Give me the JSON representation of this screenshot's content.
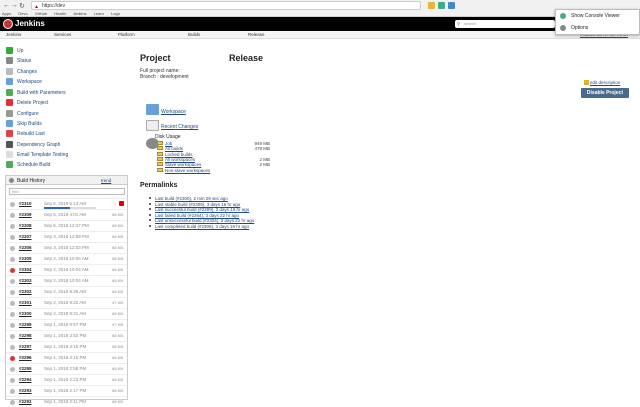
{
  "browser": {
    "url": "https://dev",
    "bookmarks": [
      "Apps",
      "Devo",
      "GitHub",
      "Health",
      "Jenkins",
      "Learn",
      "Logo"
    ]
  },
  "header": {
    "brand": "Jenkins",
    "search_placeholder": "search"
  },
  "breadcrumbs": [
    "Jenkins",
    "Services",
    "Platform",
    "Builds",
    "Release"
  ],
  "auto_refresh": "ENABLE AUTO REFRESH",
  "context_menu": {
    "items": [
      "Show Console Viewer",
      "Options"
    ]
  },
  "sidebar": {
    "tasks": [
      {
        "label": "Up",
        "icon": "up-arrow-icon",
        "color": "#3a3"
      },
      {
        "label": "Status",
        "icon": "search-icon",
        "color": "#888"
      },
      {
        "label": "Changes",
        "icon": "notepad-icon",
        "color": "#bbb"
      },
      {
        "label": "Workspace",
        "icon": "folder-icon",
        "color": "#6a9fd8"
      },
      {
        "label": "Build with Parameters",
        "icon": "build-icon",
        "color": "#5a5"
      },
      {
        "label": "Delete Project",
        "icon": "delete-icon",
        "color": "#d33"
      },
      {
        "label": "Configure",
        "icon": "gear-icon",
        "color": "#999"
      },
      {
        "label": "Skip Builds",
        "icon": "skip-icon",
        "color": "#6a9fd8"
      },
      {
        "label": "Rebuild Last",
        "icon": "rebuild-icon",
        "color": "#d44"
      },
      {
        "label": "Dependency Graph",
        "icon": "graph-icon",
        "color": "#555"
      },
      {
        "label": "Email Template Testing",
        "icon": "email-icon",
        "color": "#ddd"
      },
      {
        "label": "Schedule Build",
        "icon": "clock-icon",
        "color": "#5a5"
      }
    ]
  },
  "build_history": {
    "title": "Build History",
    "trend": "trend",
    "filter_placeholder": "find",
    "builds": [
      {
        "num": "#2310",
        "date": "Sep 6, 2018 6:13 AM",
        "size": "",
        "status": "#bbb",
        "progress": 0.5
      },
      {
        "num": "#2309",
        "date": "Sep 6, 2018 4:01 AM",
        "size": "66 KB",
        "status": "#bbb"
      },
      {
        "num": "#2308",
        "date": "Sep 5, 2018 12:37 PM",
        "size": "68 KB",
        "status": "#bbb"
      },
      {
        "num": "#2307",
        "date": "Sep 3, 2018 12:59 PM",
        "size": "66 KB",
        "status": "#bbb"
      },
      {
        "num": "#2306",
        "date": "Sep 3, 2018 12:53 PM",
        "size": "66 KB",
        "status": "#bbb"
      },
      {
        "num": "#2305",
        "date": "Sep 2, 2018 10:05 AM",
        "size": "66 KB",
        "status": "#bbb"
      },
      {
        "num": "#2304",
        "date": "Sep 2, 2018 10:04 AM",
        "size": "66 KB",
        "status": "#d33"
      },
      {
        "num": "#2303",
        "date": "Sep 2, 2018 10:04 AM",
        "size": "66 KB",
        "status": "#bbb"
      },
      {
        "num": "#2302",
        "date": "Sep 2, 2018 9:26 AM",
        "size": "66 KB",
        "status": "#bbb"
      },
      {
        "num": "#2301",
        "date": "Sep 2, 2018 9:22 AM",
        "size": "47 KB",
        "status": "#bbb"
      },
      {
        "num": "#2300",
        "date": "Sep 2, 2018 9:21 AM",
        "size": "66 KB",
        "status": "#bbb"
      },
      {
        "num": "#2299",
        "date": "Sep 1, 2018 9:57 PM",
        "size": "47 KB",
        "status": "#bbb"
      },
      {
        "num": "#2298",
        "date": "Sep 1, 2018 3:52 PM",
        "size": "66 KB",
        "status": "#bbb"
      },
      {
        "num": "#2297",
        "date": "Sep 1, 2018 3:16 PM",
        "size": "66 KB",
        "status": "#bbb"
      },
      {
        "num": "#2296",
        "date": "Sep 1, 2018 3:15 PM",
        "size": "66 KB",
        "status": "#d33"
      },
      {
        "num": "#2295",
        "date": "Sep 1, 2018 2:58 PM",
        "size": "66 KB",
        "status": "#bbb"
      },
      {
        "num": "#2294",
        "date": "Sep 1, 2018 2:23 PM",
        "size": "66 KB",
        "status": "#bbb"
      },
      {
        "num": "#2293",
        "date": "Sep 1, 2018 2:17 PM",
        "size": "66 KB",
        "status": "#bbb"
      },
      {
        "num": "#2292",
        "date": "Sep 1, 2018 2:11 PM",
        "size": "66 KB",
        "status": "#bbb"
      }
    ]
  },
  "main": {
    "title_left": "Project",
    "title_right": "Release",
    "description_line1": "Full project name:",
    "description_line2": "Branch : development",
    "edit_description": "edit description",
    "disable_button": "Disable Project",
    "workspace_link": "Workspace",
    "recent_changes_link": "Recent Changes",
    "disk_usage_title": "Disk Usage",
    "disk_usage": [
      {
        "label": "Job",
        "value": "949 MB"
      },
      {
        "label": "All builds",
        "value": "478 MB"
      },
      {
        "label": "Locked builds",
        "value": ""
      },
      {
        "label": "All workspaces",
        "value": "2 MB"
      },
      {
        "label": "Slave workspaces",
        "value": "2 MB"
      },
      {
        "label": "Non-slave workspaces",
        "value": ""
      }
    ],
    "permalinks_title": "Permalinks",
    "permalinks": [
      "Last build (#2300), 2 min 29 sec ago",
      "Last stable build (#2309), 3 days 16 hr ago",
      "Last successful build (#2309), 3 days 16 hr ago",
      "Last failed build (#2264), 3 days 22 hr ago",
      "Last unsuccessful build (#2304), 3 days 22 hr ago",
      "Last completed build (#2309), 3 days 16 hr ago"
    ]
  }
}
